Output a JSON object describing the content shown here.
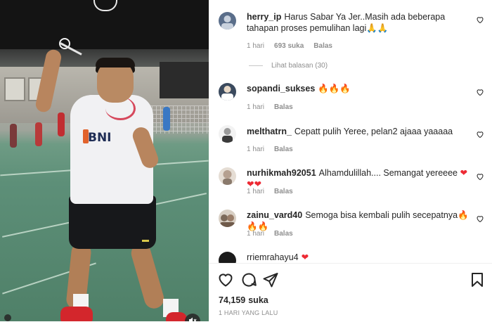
{
  "post": {
    "comments": [
      {
        "username": "herry_ip",
        "text": "Harus Sabar Ya Jer..Masih ada beberapa tahapan proses pemulihan lagi",
        "emoji": "🙏🙏",
        "time": "1 hari",
        "likes": "693 suka",
        "reply": "Balas",
        "view_replies": "Lihat balasan (30)",
        "avatar_color": "#5a6e8a"
      },
      {
        "username": "sopandi_sukses",
        "text": "",
        "emoji": "🔥🔥🔥",
        "time": "1 hari",
        "reply": "Balas",
        "avatar_color": "#3b4a5e"
      },
      {
        "username": "melthatrn_",
        "text": "Cepatt pulih Yeree, pelan2 ajaaa yaaaaa",
        "emoji": "",
        "time": "1 hari",
        "reply": "Balas",
        "avatar_color": "#9a9a9a"
      },
      {
        "username": "nurhikmah92051",
        "text": "Alhamdulillah.... Semangat yereeee",
        "emoji": "❤❤❤",
        "time": "1 hari",
        "reply": "Balas",
        "avatar_color": "#b5a090"
      },
      {
        "username": "zainu_vard40",
        "text": "Semoga bisa kembali pulih secepatnya",
        "emoji": "🔥🔥🔥",
        "time": "1 hari",
        "reply": "Balas",
        "avatar_color": "#7c6a5a"
      },
      {
        "username": "rriemrahayu4",
        "text": "",
        "emoji": "❤",
        "avatar_color": "#1b1b1b"
      }
    ],
    "likes_count": "74,159",
    "likes_label": "suka",
    "posted": "1 HARI YANG LALU",
    "icons": {
      "like": "heart-outline-icon",
      "comment": "comment-bubble-icon",
      "share": "paper-plane-icon",
      "save": "bookmark-icon",
      "mute": "speaker-muted-icon"
    },
    "colors": {
      "text": "#262626",
      "meta": "#8e8e8e",
      "fire": "#e8760f",
      "heart": "#ed2a34"
    }
  }
}
